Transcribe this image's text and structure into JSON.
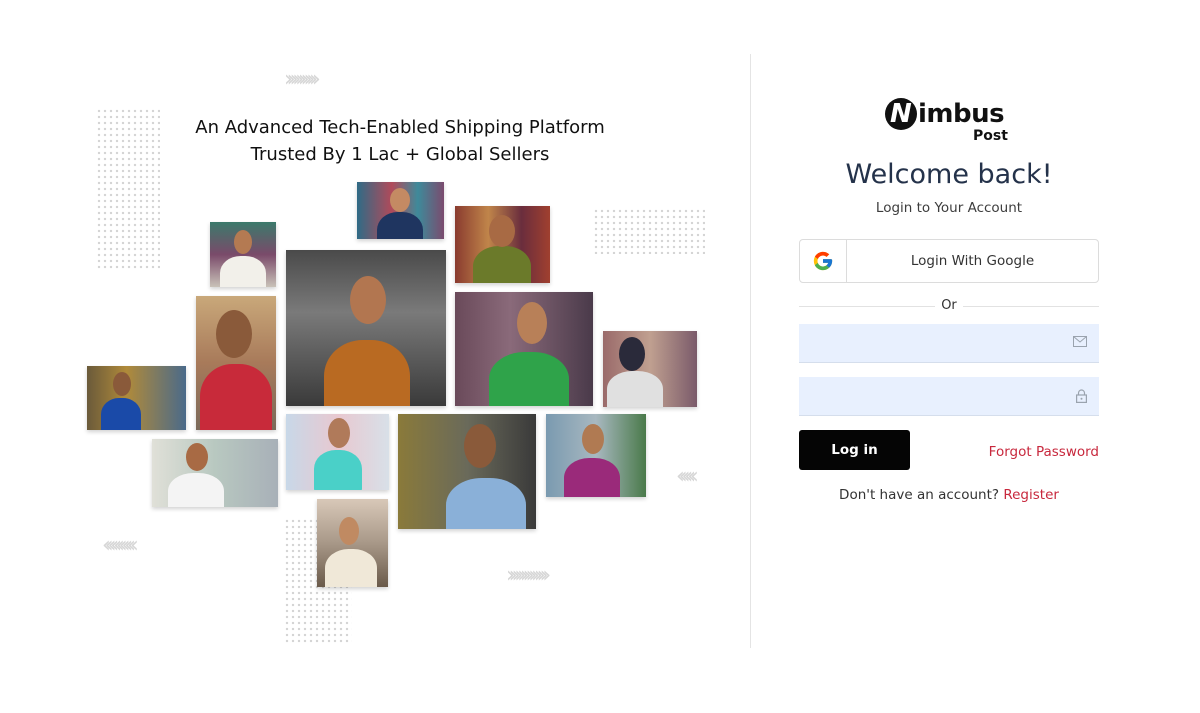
{
  "hero": {
    "headline_line1": "An Advanced Tech-Enabled Shipping Platform",
    "headline_line2": "Trusted By 1 Lac + Global Sellers"
  },
  "brand": {
    "logo_main": "imbus",
    "logo_letter": "N",
    "logo_sub": "Post"
  },
  "login": {
    "welcome": "Welcome back!",
    "subtitle": "Login to Your Account",
    "google_button": "Login With Google",
    "separator": "Or",
    "email_placeholder": "",
    "password_placeholder": "",
    "login_button": "Log in",
    "forgot_password": "Forgot Password",
    "no_account_text": "Don't have an account?",
    "register_link": "Register"
  },
  "icons": {
    "google": "google-icon",
    "email": "mail-icon",
    "password": "lock-icon"
  },
  "colors": {
    "accent_red": "#c8283d",
    "button_black": "#050505",
    "input_bg": "#e8f0fe",
    "heading": "#24324a"
  }
}
